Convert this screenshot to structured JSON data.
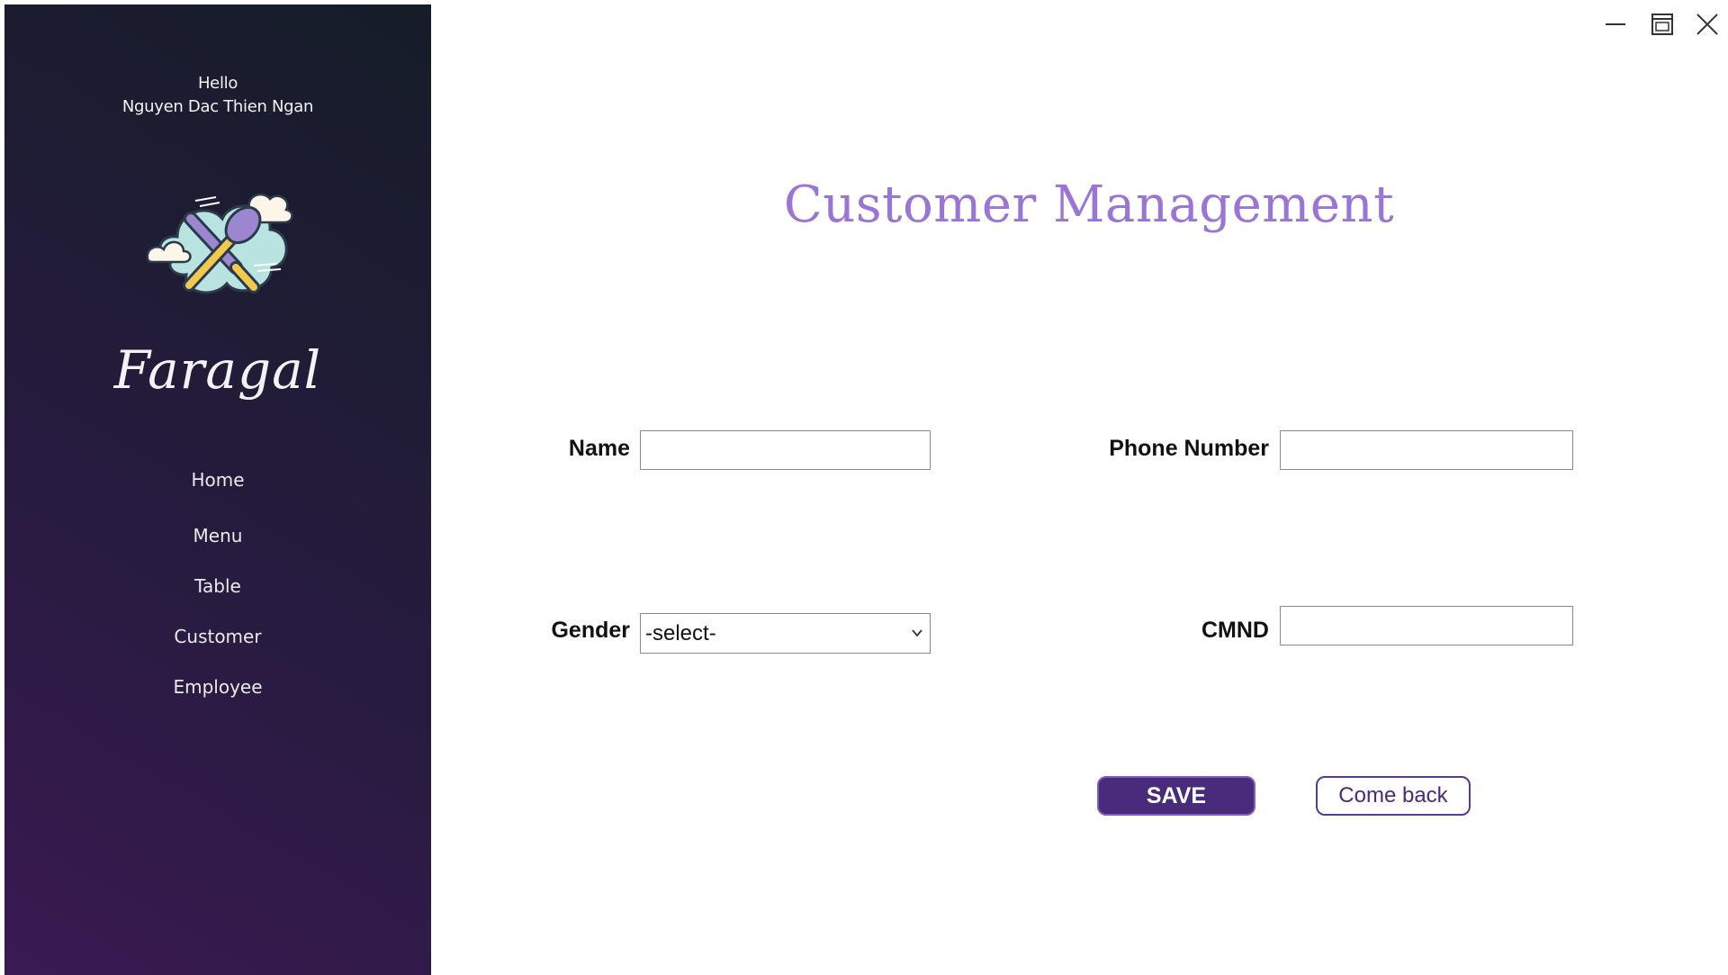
{
  "sidebar": {
    "greeting": "Hello",
    "user_name": "Nguyen Dac Thien Ngan",
    "logo_icon": "crossed-knife-spoon-cloud-icon",
    "brand": "Faragal",
    "nav": [
      {
        "label": "Home"
      },
      {
        "label": "Menu"
      },
      {
        "label": "Table"
      },
      {
        "label": "Customer"
      },
      {
        "label": "Employee"
      }
    ]
  },
  "window_controls": {
    "minimize_icon": "minimize-icon",
    "maximize_icon": "restore-icon",
    "close_icon": "close-icon"
  },
  "main": {
    "title": "Customer Management",
    "form": {
      "name_label": "Name",
      "name_value": "",
      "phone_label": "Phone Number",
      "phone_value": "",
      "gender_label": "Gender",
      "gender_selected": "-select-",
      "cmnd_label": "CMND",
      "cmnd_value": ""
    },
    "buttons": {
      "save": "SAVE",
      "back": "Come back"
    }
  },
  "colors": {
    "sidebar_dark": "#1b1d2c",
    "sidebar_purple": "#3a1a52",
    "title": "#9a74d6",
    "save_button": "#4a2a7a"
  }
}
